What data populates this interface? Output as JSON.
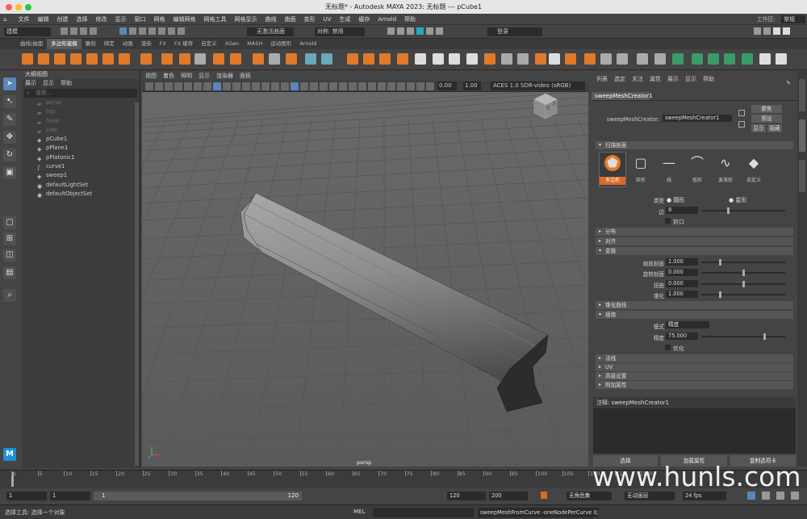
{
  "window": {
    "title": "无标题* - Autodesk MAYA 2023: 无标题  ---  pCube1"
  },
  "menu": [
    "文件",
    "编辑",
    "创建",
    "选择",
    "修改",
    "显示",
    "窗口",
    "网格",
    "编辑网格",
    "网格工具",
    "网格显示",
    "曲线",
    "曲面",
    "变形",
    "UV",
    "生成",
    "缓存",
    "Arnold",
    "帮助"
  ],
  "workspace": {
    "label": "工作区:",
    "value": "常规"
  },
  "status": {
    "mode": "建模",
    "live_surface": "无激活曲面",
    "symmetry": "对称: 禁用",
    "login": "登录"
  },
  "shelf_tabs": [
    "曲线/曲面",
    "多边形建模",
    "雕刻",
    "绑定",
    "动画",
    "渲染",
    "FX",
    "FX 缓存",
    "自定义",
    "XGen",
    "MASH",
    "运动图形",
    "Arnold"
  ],
  "shelf_active": "多边形建模",
  "outliner": {
    "title": "大纲视图",
    "menu": [
      "展示",
      "显示",
      "帮助"
    ],
    "search_placeholder": "搜索...",
    "items": [
      {
        "name": "persp",
        "icon": "camera-icon",
        "dim": true
      },
      {
        "name": "top",
        "icon": "camera-icon",
        "dim": true
      },
      {
        "name": "front",
        "icon": "camera-icon",
        "dim": true
      },
      {
        "name": "side",
        "icon": "camera-icon",
        "dim": true
      },
      {
        "name": "pCube1",
        "icon": "mesh-icon",
        "dim": false
      },
      {
        "name": "pPlane1",
        "icon": "mesh-icon",
        "dim": false
      },
      {
        "name": "pPlatonic1",
        "icon": "mesh-icon",
        "dim": false
      },
      {
        "name": "curve1",
        "icon": "curve-icon",
        "dim": false
      },
      {
        "name": "sweep1",
        "icon": "mesh-icon",
        "dim": false
      },
      {
        "name": "defaultLightSet",
        "icon": "set-icon",
        "dim": false
      },
      {
        "name": "defaultObjectSet",
        "icon": "set-icon",
        "dim": false
      }
    ]
  },
  "viewport": {
    "menu": [
      "视图",
      "着色",
      "照明",
      "显示",
      "渲染器",
      "面板"
    ],
    "camera_label": "persp",
    "exposure": "0.00",
    "gamma": "1.00",
    "colorspace": "ACES 1.0 SDR-video (sRGB)",
    "viewcube_front": "前",
    "viewcube_right": "右"
  },
  "attr_editor": {
    "menu": [
      "列表",
      "选定",
      "关注",
      "属性",
      "展示",
      "显示",
      "帮助"
    ],
    "node_tab": "sweepMeshCreator1",
    "type_label": "sweepMeshCreator:",
    "node_name": "sweepMeshCreator1",
    "buttons": {
      "focus": "聚焦",
      "presets": "预设",
      "show": "显示",
      "hide": "隐藏"
    },
    "profile_section": "扫描剖面",
    "profiles": [
      "多边形",
      "矩形",
      "线",
      "弧形",
      "波浪形",
      "自定义"
    ],
    "active_profile": "多边形",
    "type_label2": "类型",
    "type_opt1": "圆形",
    "type_opt2": "星形",
    "sides_label": "边",
    "sides": "8",
    "cap_label": "封口",
    "collapsed1": [
      "分布",
      "对齐"
    ],
    "transform_section": "变换",
    "scale_label": "缩放剖面",
    "scale": "1.000",
    "rotate_label": "旋转剖面",
    "rotate": "0.000",
    "twist_label": "扭曲",
    "twist": "0.000",
    "taper_label": "锥化",
    "taper": "1.000",
    "taper_curve": "锥化曲线",
    "interp_section": "插值",
    "mode_label": "模式",
    "mode": "精度",
    "precision_label": "精度",
    "precision": "75.000",
    "optimize_label": "优化",
    "collapsed2": [
      "法线",
      "UV",
      "高级设置",
      "附加属性"
    ],
    "notes_label": "注释: sweepMeshCreator1",
    "bottom_buttons": [
      "选择",
      "加载属性",
      "复制选项卡"
    ]
  },
  "timeline": {
    "ticks": [
      "1",
      "5",
      "10",
      "15",
      "20",
      "25",
      "30",
      "35",
      "40",
      "45",
      "50",
      "55",
      "60",
      "65",
      "70",
      "75",
      "80",
      "85",
      "90",
      "95",
      "100",
      "105",
      "110",
      "115",
      "120"
    ],
    "current": "1"
  },
  "range": {
    "start": "1",
    "start2": "1",
    "range_start": "1",
    "range_end": "120",
    "end": "120",
    "end2": "200",
    "char_set": "无角色集",
    "anim_layer": "无动画层",
    "fps": "24 fps"
  },
  "cmd": {
    "lang": "MEL",
    "text": "sweepMeshFromCurve -oneNodePerCurve 0;",
    "help": "选择工具: 选择一个对象"
  },
  "watermark": "www.hunls.com"
}
